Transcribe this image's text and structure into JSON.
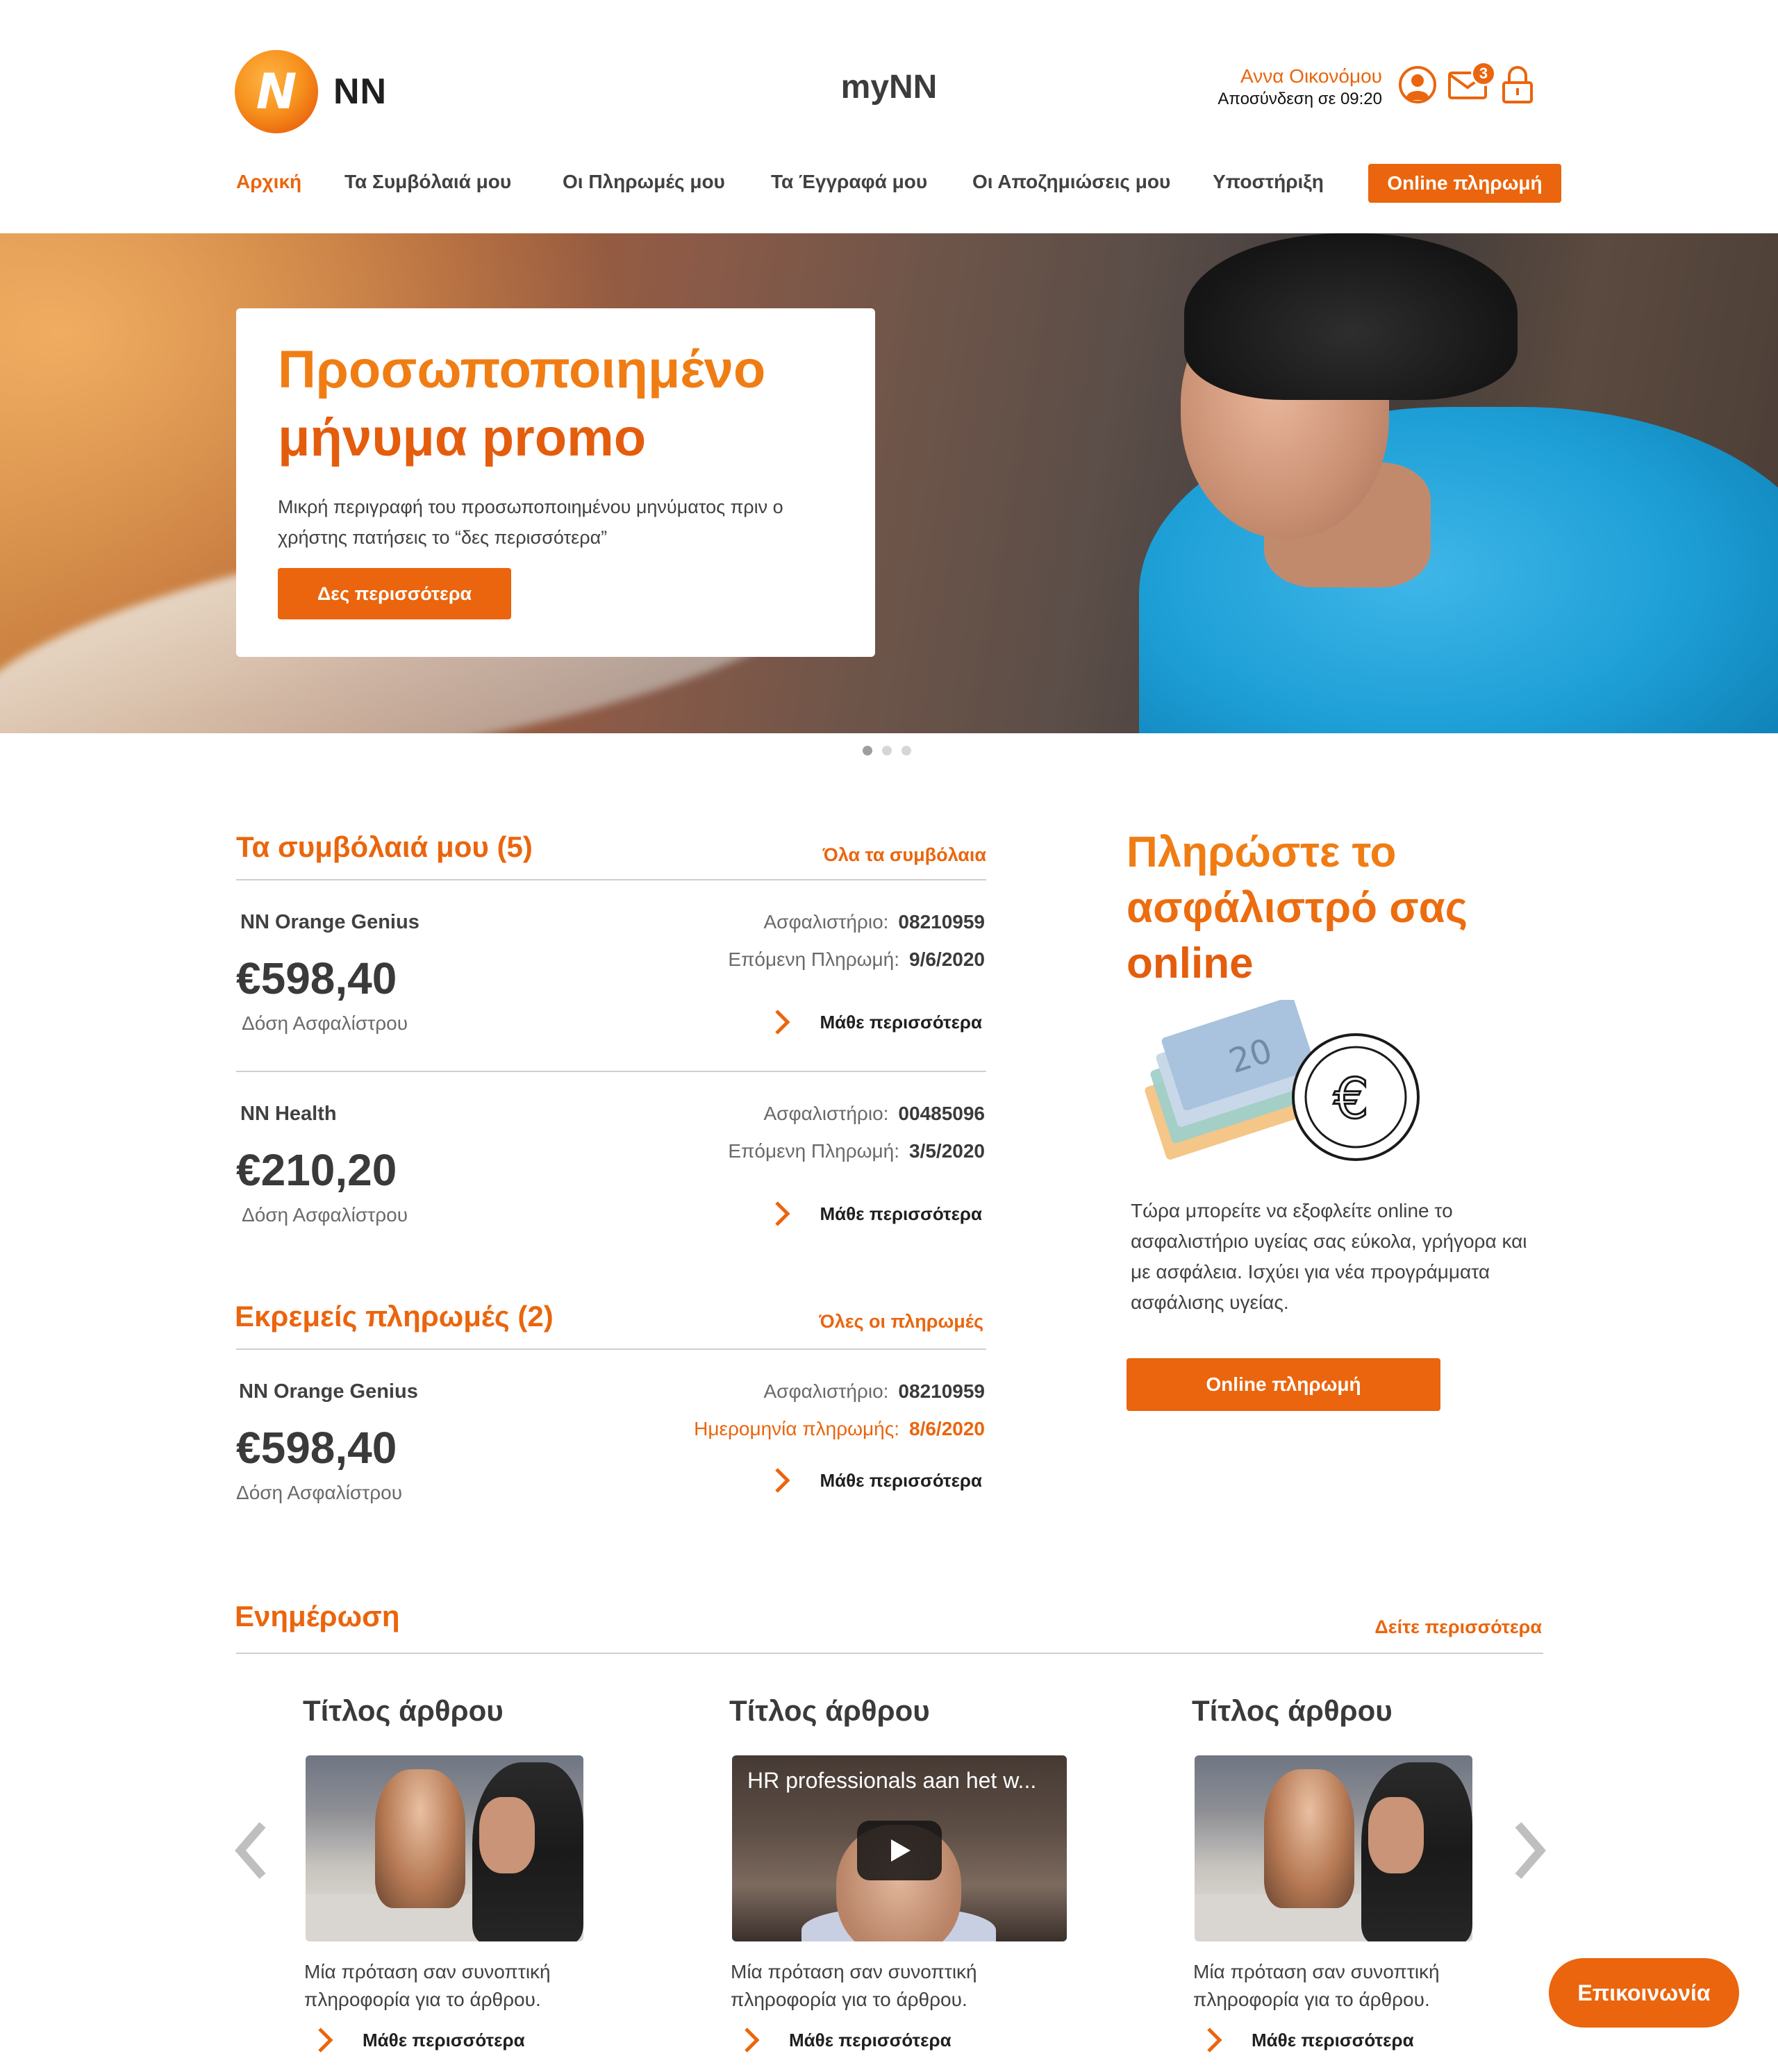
{
  "header": {
    "brand": "NN",
    "logo_mark": "N",
    "app_title": "myNN",
    "user_name": "Αννα Οικονόμου",
    "logout_text": "Αποσύνδεση σε 09:20",
    "mail_count": "3",
    "icons": [
      "user-icon",
      "mail-icon",
      "lock-icon"
    ]
  },
  "nav": {
    "items": [
      "Αρχική",
      "Τα Συμβόλαιά μου",
      "Οι Πληρωμές μου",
      "Τα Έγγραφά μου",
      "Οι Αποζημιώσεις μου",
      "Υποστήριξη"
    ],
    "active": "Αρχική",
    "pay_button": "Online πληρωμή"
  },
  "hero": {
    "title_line1": "Προσωποποιημένο",
    "title_line2": "μήνυμα promo",
    "description": "Μικρή περιγραφή του προσωποποιημένου μηνύματος πριν ο χρήστης πατήσεις το “δες περισσότερα”",
    "button": "Δες περισσότερα",
    "slides": 3,
    "active_slide": 1
  },
  "contracts": {
    "title": "Τα συμβόλαιά μου (5)",
    "link": "Όλα τα  συμβόλαια",
    "items": [
      {
        "product": "NN Orange Genius",
        "amount": "€598,40",
        "amount_label": "Δόση Ασφαλίστρου",
        "policy_label": "Ασφαλιστήριο:",
        "policy_no": "08210959",
        "next_label": "Επόμενη Πληρωμή:",
        "next_date": "9/6/2020",
        "more": "Μάθε περισσότερα"
      },
      {
        "product": "NN Health",
        "amount": "€210,20",
        "amount_label": "Δόση Ασφαλίστρου",
        "policy_label": "Ασφαλιστήριο:",
        "policy_no": "00485096",
        "next_label": "Επόμενη Πληρωμή:",
        "next_date": "3/5/2020",
        "more": "Μάθε περισσότερα"
      }
    ]
  },
  "pending": {
    "title": "Εκρεμείς πληρωμές (2)",
    "link": "Όλες οι πληρωμές",
    "items": [
      {
        "product": "NN Orange Genius",
        "amount": "€598,40",
        "amount_label": "Δόση Ασφαλίστρου",
        "policy_label": "Ασφαλιστήριο:",
        "policy_no": "08210959",
        "date_label": "Ημερομηνία πληρωμής:",
        "date": "8/6/2020",
        "more": "Μάθε περισσότερα"
      }
    ]
  },
  "pay_online": {
    "title_line1": "Πληρώστε το",
    "title_line2": "ασφάλιστρό σας",
    "title_line3": "online",
    "description": "Τώρα μπορείτε να εξοφλείτε online το ασφαλιστήριο υγείας σας εύκολα, γρήγορα και με ασφάλεια. Ισχύει για νέα προγράμματα ασφάλισης υγείας.",
    "button": "Online πληρωμή"
  },
  "news": {
    "title": "Ενημέρωση",
    "link": "Δείτε περισσότερα",
    "articles": [
      {
        "title": "Τίτλος άρθρου",
        "description": "Μία πρόταση σαν συνοπτική πληροφορία για το άρθρου.",
        "more": "Μάθε περισσότερα",
        "media": "photo"
      },
      {
        "title": "Τίτλος άρθρου",
        "description": "Μία πρόταση σαν συνοπτική πληροφορία για το άρθρου.",
        "more": "Μάθε περισσότερα",
        "media": "video",
        "video_title": "HR professionals aan het w..."
      },
      {
        "title": "Τίτλος άρθρου",
        "description": "Μία πρόταση σαν συνοπτική πληροφορία για το άρθρου.",
        "more": "Μάθε περισσότερα",
        "media": "photo"
      }
    ]
  },
  "contact_button": "Επικοινωνία",
  "colors": {
    "accent": "#ea650d",
    "accent_light": "#f07d14",
    "text": "#414141"
  }
}
